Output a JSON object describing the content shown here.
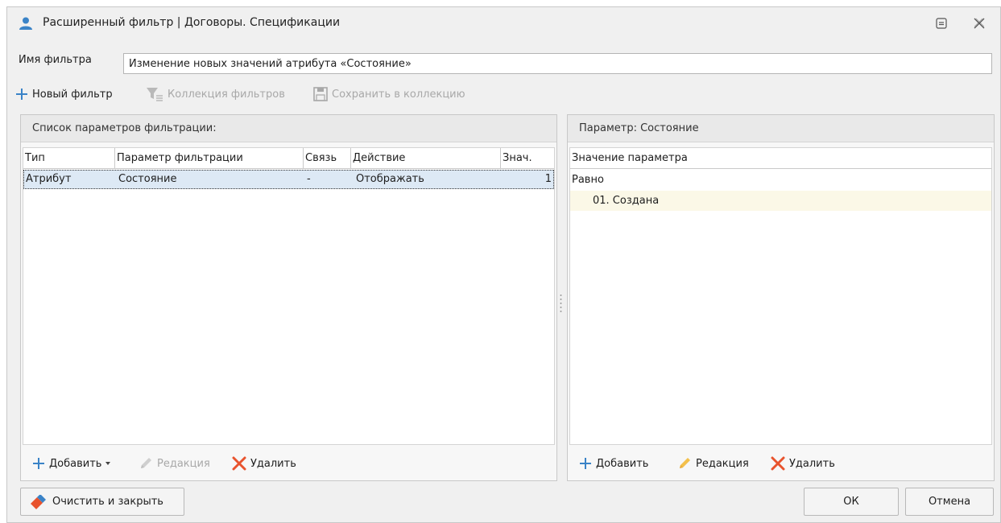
{
  "window": {
    "title": "Расширенный фильтр | Договоры. Спецификации",
    "icons": {
      "app": "user-icon",
      "restore": "restore-icon",
      "close": "close-icon"
    }
  },
  "filter_name": {
    "label": "Имя фильтра",
    "value": "Изменение новых значений атрибута «Состояние»"
  },
  "toolbar": {
    "new_filter": "Новый фильтр",
    "collection": "Коллекция фильтров",
    "save_to_collection": "Сохранить в коллекцию"
  },
  "left_panel": {
    "title": "Список параметров фильтрации:",
    "columns": [
      "Тип",
      "Параметр фильтрации",
      "Связь",
      "Действие",
      "Знач."
    ],
    "rows": [
      {
        "type": "Атрибут",
        "param": "Состояние",
        "link": "-",
        "action": "Отображать",
        "value": "1"
      }
    ],
    "footer": {
      "add": "Добавить",
      "edit": "Редакция",
      "delete": "Удалить"
    }
  },
  "right_panel": {
    "title": "Параметр: Состояние",
    "column": "Значение параметра",
    "group": "Равно",
    "values": [
      "01. Создана"
    ],
    "footer": {
      "add": "Добавить",
      "edit": "Редакция",
      "delete": "Удалить"
    }
  },
  "buttons": {
    "clear_close": "Очистить и закрыть",
    "ok": "ОК",
    "cancel": "Отмена"
  },
  "colors": {
    "selection": "#dde9f5",
    "value_highlight": "#fbf8e7",
    "accent_blue": "#3a83c7",
    "delete_red": "#e8532d",
    "pencil_yellow": "#f3c04c"
  }
}
